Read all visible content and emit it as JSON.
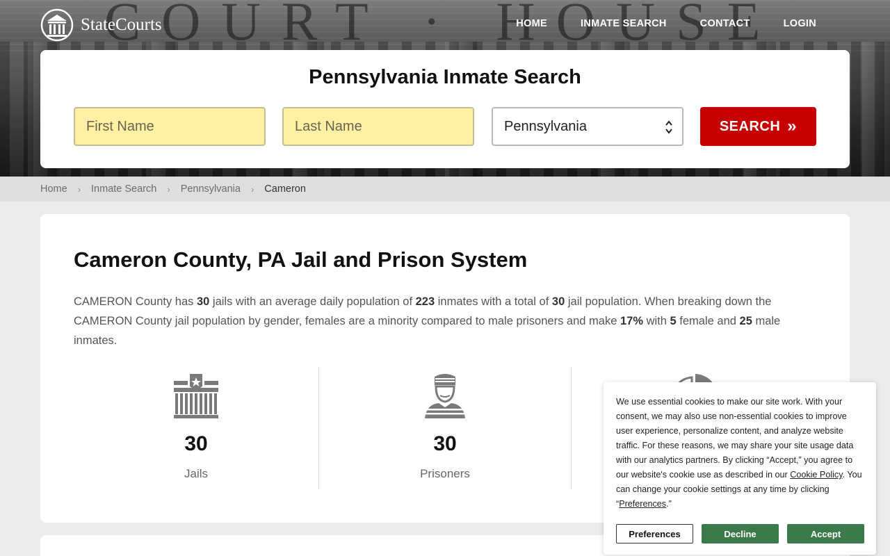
{
  "brand": {
    "name": "StateCourts",
    "hero_engraving": "COURT · HOUSE"
  },
  "nav": [
    {
      "label": "HOME"
    },
    {
      "label": "INMATE SEARCH"
    },
    {
      "label": "CONTACT"
    },
    {
      "label": "LOGIN"
    }
  ],
  "search": {
    "title": "Pennsylvania Inmate Search",
    "first_name_placeholder": "First Name",
    "last_name_placeholder": "Last Name",
    "state_selected": "Pennsylvania",
    "button_label": "SEARCH",
    "button_chevron": "»"
  },
  "breadcrumb": {
    "items": [
      "Home",
      "Inmate Search",
      "Pennsylvania"
    ],
    "current": "Cameron",
    "separator": "›"
  },
  "county": {
    "title": "Cameron County, PA Jail and Prison System",
    "desc": {
      "t1": "CAMERON County has ",
      "jails": "30",
      "t2": " jails with an average daily population of ",
      "avg_daily": "223",
      "t3": " inmates with a total of ",
      "total": "30",
      "t4": " jail population. When breaking down the CAMERON County jail population by gender, females are a minority compared to male prisoners and make ",
      "female_pct": "17%",
      "t5": " with ",
      "female": "5",
      "t6": " female and ",
      "male": "25",
      "t7": " male inmates."
    },
    "stats": [
      {
        "value": "30",
        "label": "Jails",
        "icon": "jail-icon"
      },
      {
        "value": "30",
        "label": "Prisoners",
        "icon": "prisoner-icon"
      }
    ]
  },
  "cookie": {
    "text_before": "We use essential cookies to make our site work. With your consent, we may also use non-essential cookies to improve user experience, personalize content, and analyze website traffic. For these reasons, we may share your site usage data with our analytics partners. By clicking “Accept,” you agree to our website's cookie use as described in our ",
    "policy_link": "Cookie Policy",
    "text_middle": ". You can change your cookie settings at any time by clicking “",
    "preferences_link": "Preferences",
    "text_end": ".”",
    "buttons": {
      "preferences": "Preferences",
      "decline": "Decline",
      "accept": "Accept"
    }
  },
  "colors": {
    "search_button": "#c60000",
    "name_field_bg": "#fff0a3",
    "cookie_green": "#3c7a4c"
  }
}
